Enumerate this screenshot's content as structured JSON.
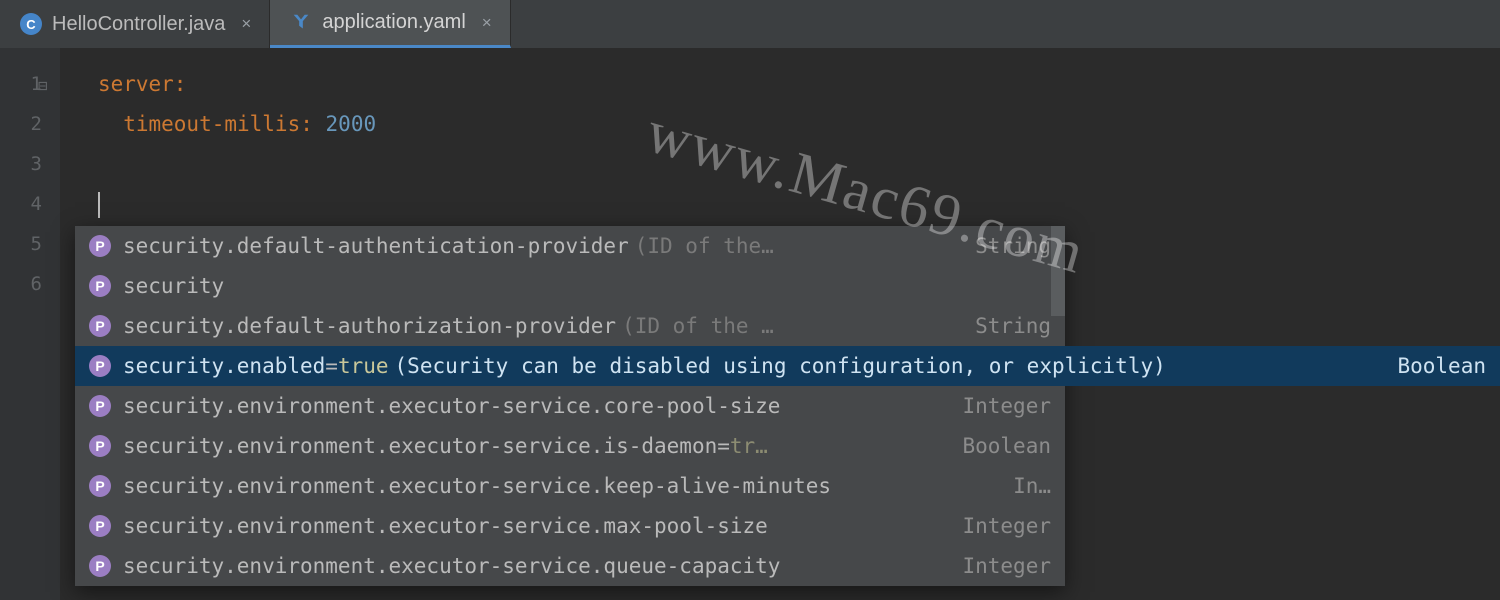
{
  "tabs": [
    {
      "name": "HelloController.java",
      "icon": "C",
      "iconClass": "java-c",
      "active": false
    },
    {
      "name": "application.yaml",
      "icon": "Y",
      "iconClass": "yaml",
      "active": true
    }
  ],
  "gutter_lines": [
    "1",
    "2",
    "3",
    "4",
    "5",
    "6"
  ],
  "code": {
    "line1_key": "server",
    "line2_key": "timeout-millis",
    "line2_val": "2000"
  },
  "completion": {
    "items": [
      {
        "label": "security.default-authentication-provider",
        "defval": "",
        "hint": "(ID of the…",
        "type": "String",
        "selected": false
      },
      {
        "label": "security",
        "defval": "",
        "hint": "",
        "type": "",
        "selected": false
      },
      {
        "label": "security.default-authorization-provider",
        "defval": "",
        "hint": "(ID of the …",
        "type": "String",
        "selected": false
      },
      {
        "label": "security.enabled",
        "defval": "true",
        "hint": "(Security can be disabled using configuration, or explicitly)",
        "type": "Boolean",
        "selected": true
      },
      {
        "label": "security.environment.executor-service.core-pool-size",
        "defval": "",
        "hint": "",
        "type": "Integer",
        "selected": false
      },
      {
        "label": "security.environment.executor-service.is-daemon",
        "defval": "tr…",
        "hint": "",
        "type": "Boolean",
        "selected": false
      },
      {
        "label": "security.environment.executor-service.keep-alive-minutes",
        "defval": "",
        "hint": "",
        "type": "In…",
        "selected": false
      },
      {
        "label": "security.environment.executor-service.max-pool-size",
        "defval": "",
        "hint": "",
        "type": "Integer",
        "selected": false
      },
      {
        "label": "security.environment.executor-service.queue-capacity",
        "defval": "",
        "hint": "",
        "type": "Integer",
        "selected": false
      }
    ]
  },
  "watermark": "www.Mac69.com"
}
